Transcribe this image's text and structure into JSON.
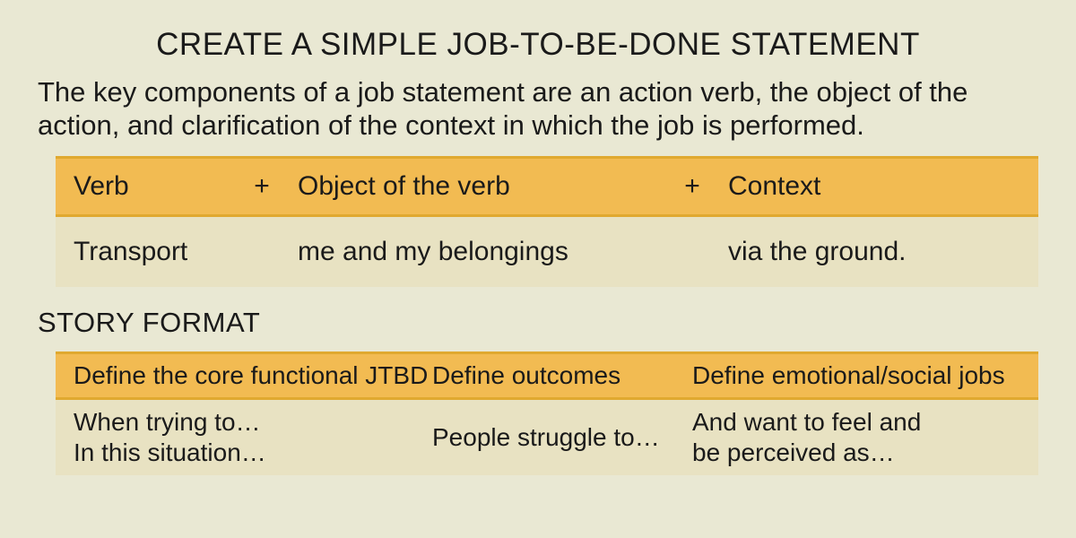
{
  "title": "CREATE A SIMPLE JOB-TO-BE-DONE STATEMENT",
  "lead": "The key components of a job statement are an action verb, the object of the action, and clarification of the context in which the job is performed.",
  "plus": "+",
  "table1": {
    "header": {
      "verb": "Verb",
      "object": "Object of the verb",
      "context": "Context"
    },
    "row": {
      "verb": "Transport",
      "object": "me and my belongings",
      "context": "via the ground."
    }
  },
  "section2_title": "STORY FORMAT",
  "table2": {
    "header": {
      "col1": "Define the core functional JTBD",
      "col2": "Define outcomes",
      "col3": "Define emotional/social jobs"
    },
    "row": {
      "col1": "When trying to…\nIn this situation…",
      "col2": "People struggle to…",
      "col3": "And want to feel and\nbe perceived as…"
    }
  }
}
